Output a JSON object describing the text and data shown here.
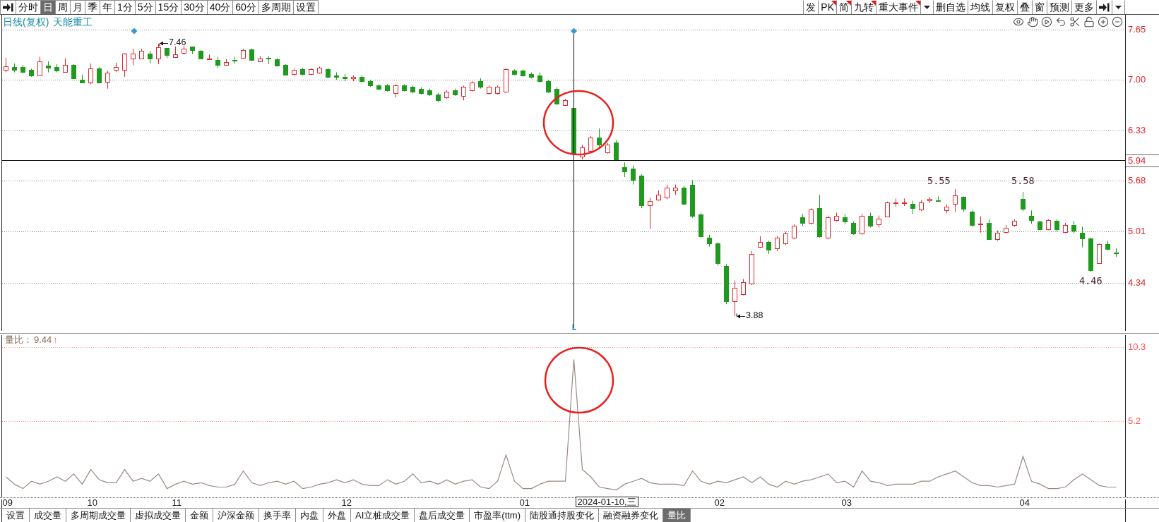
{
  "toolbar": {
    "left": [
      {
        "label": "分时",
        "selected": false
      },
      {
        "label": "日",
        "selected": true
      },
      {
        "label": "周",
        "selected": false
      },
      {
        "label": "月",
        "selected": false
      },
      {
        "label": "季",
        "selected": false
      },
      {
        "label": "年",
        "selected": false
      },
      {
        "label": "1分",
        "selected": false
      },
      {
        "label": "5分",
        "selected": false
      },
      {
        "label": "15分",
        "selected": false
      },
      {
        "label": "30分",
        "selected": false
      },
      {
        "label": "40分",
        "selected": false
      },
      {
        "label": "60分",
        "selected": false
      },
      {
        "label": "多周期",
        "selected": false
      },
      {
        "label": "设置",
        "selected": false
      }
    ],
    "right": [
      {
        "kind": "text",
        "label": "发",
        "flagged": false
      },
      {
        "kind": "text",
        "label": "PK",
        "flagged": true
      },
      {
        "kind": "text",
        "label": "简",
        "flagged": true
      },
      {
        "kind": "text",
        "label": "九转",
        "flagged": true
      },
      {
        "kind": "text",
        "label": "重大事件",
        "flagged": true
      },
      {
        "kind": "caret"
      },
      {
        "kind": "text",
        "label": "删自选",
        "flagged": false
      },
      {
        "kind": "text",
        "label": "均线",
        "flagged": false
      },
      {
        "kind": "text",
        "label": "复权",
        "flagged": false
      },
      {
        "kind": "text",
        "label": "叠",
        "flagged": false
      },
      {
        "kind": "text",
        "label": "窗",
        "flagged": false
      },
      {
        "kind": "text",
        "label": "预测",
        "flagged": false
      },
      {
        "kind": "text",
        "label": "更多",
        "flagged": false
      },
      {
        "kind": "arrow_bar"
      },
      {
        "kind": "caret"
      }
    ]
  },
  "price_chart": {
    "title": "日线(复权)",
    "stock": "天能重工",
    "axis_labels": [
      "7.65",
      "7.00",
      "6.33",
      "5.68",
      "5.01",
      "4.34"
    ],
    "crosshair": {
      "price": "5.94",
      "date": "2024-01-10,三"
    },
    "annotations": [
      {
        "kind": "arrow",
        "text": "7.46"
      },
      {
        "kind": "arrow",
        "text": "3.88"
      },
      {
        "kind": "plain",
        "text": "5.55"
      },
      {
        "kind": "plain",
        "text": "5.58"
      },
      {
        "kind": "plain",
        "text": "4.46"
      }
    ]
  },
  "indicator": {
    "label": "量比：",
    "value": "9.44",
    "arrow": "↑",
    "month_labels": [
      "09",
      "10",
      "11",
      "12",
      "01",
      "02",
      "03",
      "04"
    ],
    "chart_data": {
      "type": "line",
      "ylim": [
        0,
        11.2
      ],
      "yticks": [
        10.3,
        5.2
      ],
      "values": [
        1.4,
        0.9,
        0.6,
        1.1,
        0.9,
        1.1,
        1.4,
        1.1,
        1.6,
        0.9,
        1.9,
        1.2,
        1.0,
        1.0,
        1.9,
        1.1,
        1.3,
        1.1,
        1.6,
        0.6,
        0.9,
        1.1,
        0.9,
        1.0,
        0.8,
        0.7,
        0.7,
        0.9,
        1.8,
        1.0,
        0.8,
        1.0,
        1.1,
        0.9,
        1.1,
        0.6,
        0.7,
        0.9,
        1.0,
        1.2,
        1.0,
        1.2,
        0.9,
        0.8,
        0.8,
        1.2,
        0.9,
        1.1,
        1.6,
        1.0,
        1.1,
        0.9,
        1.2,
        0.9,
        1.1,
        1.2,
        0.7,
        0.6,
        1.1,
        2.9,
        1.1,
        0.6,
        0.6,
        0.9,
        1.1,
        1.1,
        1.1,
        9.44,
        1.9,
        1.4,
        0.7,
        0.6,
        0.5,
        0.9,
        1.1,
        1.3,
        1.0,
        0.9,
        0.9,
        0.9,
        0.8,
        1.8,
        1.1,
        0.9,
        1.1,
        1.0,
        1.2,
        1.4,
        1.0,
        1.4,
        0.9,
        0.7,
        1.1,
        0.9,
        1.1,
        1.2,
        1.4,
        1.6,
        1.0,
        1.1,
        0.7,
        1.8,
        1.1,
        1.0,
        0.8,
        0.9,
        0.9,
        0.9,
        1.1,
        1.1,
        1.4,
        1.6,
        1.8,
        1.4,
        1.0,
        0.8,
        0.8,
        0.7,
        0.8,
        0.9,
        2.8,
        1.1,
        0.9,
        0.6,
        0.6,
        0.7,
        1.2,
        1.6,
        1.2,
        0.8,
        0.7,
        0.7
      ]
    }
  },
  "tabs": [
    {
      "label": "设置",
      "selected": false
    },
    {
      "label": "成交量",
      "selected": false
    },
    {
      "label": "多周期成交量",
      "selected": false
    },
    {
      "label": "虚拟成交量",
      "selected": false
    },
    {
      "label": "金额",
      "selected": false
    },
    {
      "label": "沪深金额",
      "selected": false
    },
    {
      "label": "换手率",
      "selected": false
    },
    {
      "label": "内盘",
      "selected": false
    },
    {
      "label": "外盘",
      "selected": false
    },
    {
      "label": "AI立桩成交量",
      "selected": false
    },
    {
      "label": "盘后成交量",
      "selected": false
    },
    {
      "label": "市盈率(ttm)",
      "selected": false
    },
    {
      "label": "陆股通持股变化",
      "selected": false
    },
    {
      "label": "融资融券变化",
      "selected": false
    },
    {
      "label": "量比",
      "selected": true
    }
  ]
}
